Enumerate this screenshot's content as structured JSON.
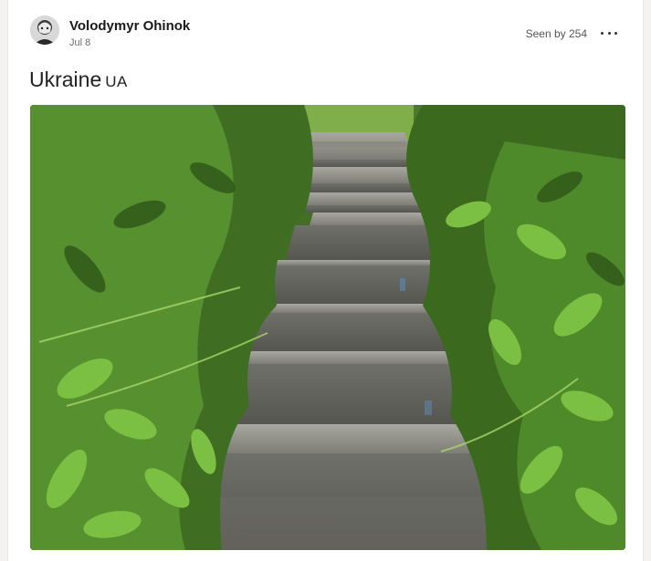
{
  "post": {
    "author": "Volodymyr Ohinok",
    "date": "Jul 8",
    "seen_by": "Seen by 254",
    "title": "Ukraine",
    "title_flag": "UA"
  },
  "colors": {
    "card_background": "#ffffff",
    "page_background": "#f3f2f1",
    "author_text": "#1a1a1a",
    "meta_text": "#6e6e6e",
    "foliage_dark": "#2f5a1c",
    "foliage_light": "#6fae3a",
    "stone": "#9a9a92"
  },
  "icons": {
    "more": "more-options-icon",
    "avatar": "avatar"
  },
  "photo": {
    "subject": "photo"
  }
}
